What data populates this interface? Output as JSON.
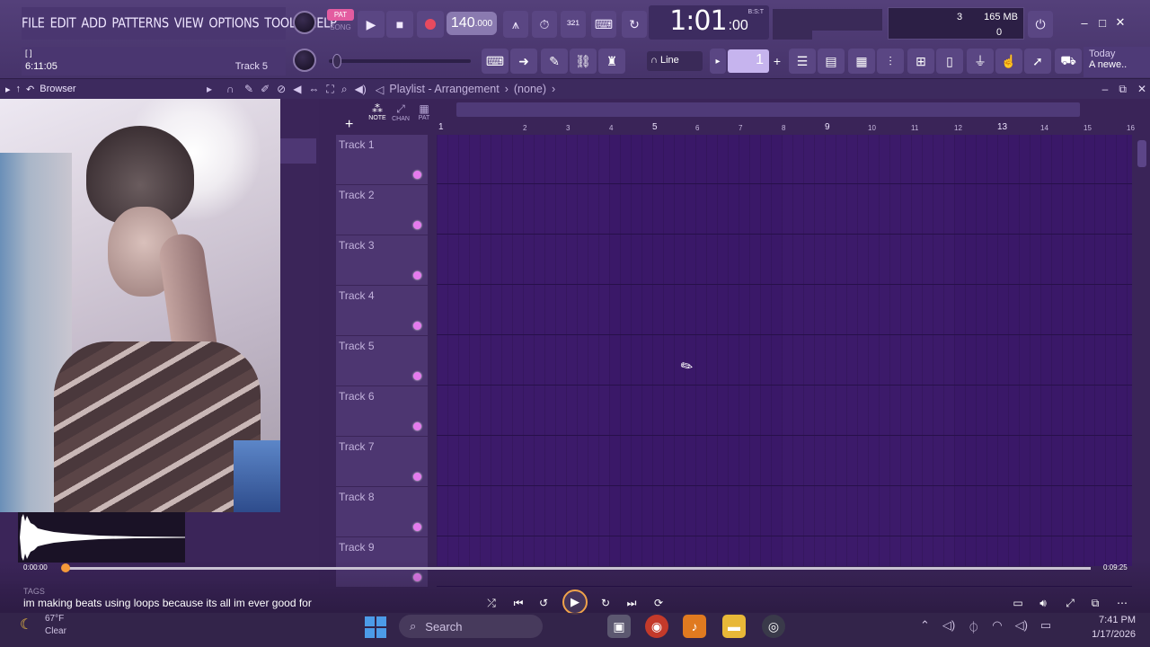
{
  "menu": [
    "FILE",
    "EDIT",
    "ADD",
    "PATTERNS",
    "VIEW",
    "OPTIONS",
    "TOOLS",
    "HELP"
  ],
  "transport": {
    "pat_label": "PAT",
    "song_label": "SONG",
    "tempo_main": "140",
    "tempo_frac": ".000"
  },
  "song_time": {
    "main": "1:01",
    "frac": ":00",
    "unit": "B:S:T"
  },
  "memory": {
    "voices": "3",
    "ram": "165 MB",
    "polyphony": "0"
  },
  "hint_bar": {
    "bracket": "[    ]",
    "time": "6:11:05",
    "track": "Track 5"
  },
  "snap": {
    "label": "Line"
  },
  "pattern": {
    "number": "1"
  },
  "news": {
    "date": "Today",
    "headline": "A newe.."
  },
  "browser": {
    "label": "Browser"
  },
  "playlist": {
    "title": "Playlist - Arrangement",
    "pattern": "(none)",
    "modes": [
      "NOTE",
      "CHAN",
      "PAT"
    ],
    "bars": [
      "1",
      "2",
      "3",
      "4",
      "5",
      "6",
      "7",
      "8",
      "9",
      "10",
      "11",
      "12",
      "13",
      "14",
      "15",
      "16",
      "1"
    ],
    "tracks": [
      "Track 1",
      "Track 2",
      "Track 3",
      "Track 4",
      "Track 5",
      "Track 6",
      "Track 7",
      "Track 8",
      "Track 9"
    ]
  },
  "player": {
    "time_current": "0:00:00",
    "time_total": "0:09:25",
    "progress": 0.0,
    "tags": "TAGS",
    "caption": "im making beats using loops because its all im ever good for"
  },
  "taskbar": {
    "weather_temp": "67°F",
    "weather_cond": "Clear",
    "search_placeholder": "Search",
    "time": "7:41 PM",
    "date": "1/17/2026"
  },
  "colors": {
    "accent": "#e35ca0",
    "playlist_bg": "#3a1868",
    "track_header": "#4d3671",
    "dot": "#e57aee"
  }
}
